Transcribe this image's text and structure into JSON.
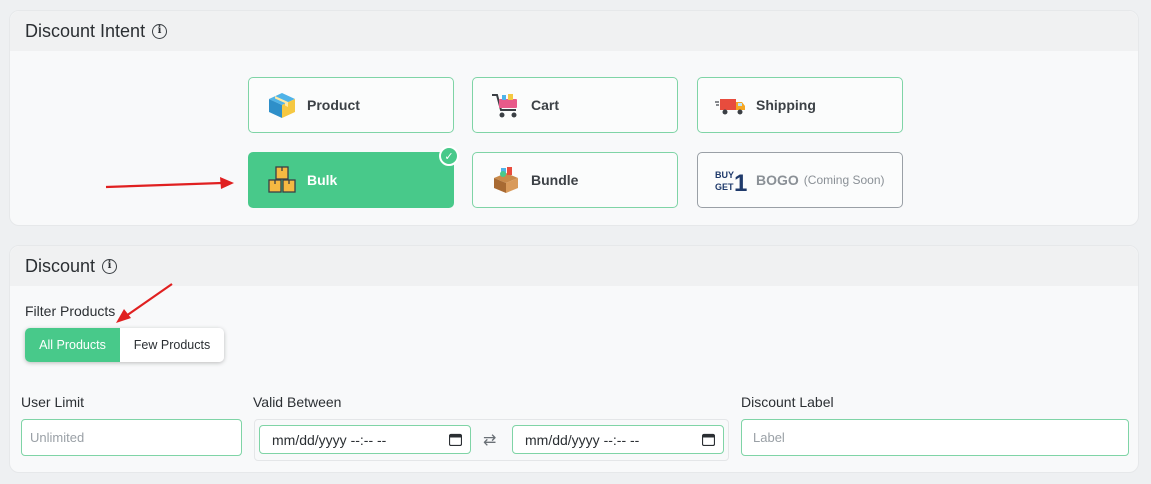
{
  "intent": {
    "title": "Discount Intent",
    "cards": [
      {
        "label": "Product",
        "icon": "product-box-icon"
      },
      {
        "label": "Cart",
        "icon": "shopping-cart-icon"
      },
      {
        "label": "Shipping",
        "icon": "delivery-truck-icon"
      },
      {
        "label": "Bulk",
        "icon": "stacked-boxes-icon",
        "selected": true
      },
      {
        "label": "Bundle",
        "icon": "bundle-box-icon"
      },
      {
        "label": "BOGO",
        "note": "(Coming Soon)",
        "icon": "buy-get-1-icon",
        "disabled": true
      }
    ]
  },
  "discount": {
    "title": "Discount",
    "filter_label": "Filter Products",
    "filter_options": [
      "All Products",
      "Few Products"
    ],
    "user_limit_label": "User Limit",
    "user_limit_placeholder": "Unlimited",
    "valid_between_label": "Valid Between",
    "date_start": "mm/dd/yyyy --:-- --",
    "date_end": "mm/dd/yyyy --:-- --",
    "discount_label_label": "Discount Label",
    "discount_label_placeholder": "Label"
  },
  "colors": {
    "accent": "#48c98a",
    "border": "#7fd4a6",
    "arrow": "#e02020"
  }
}
